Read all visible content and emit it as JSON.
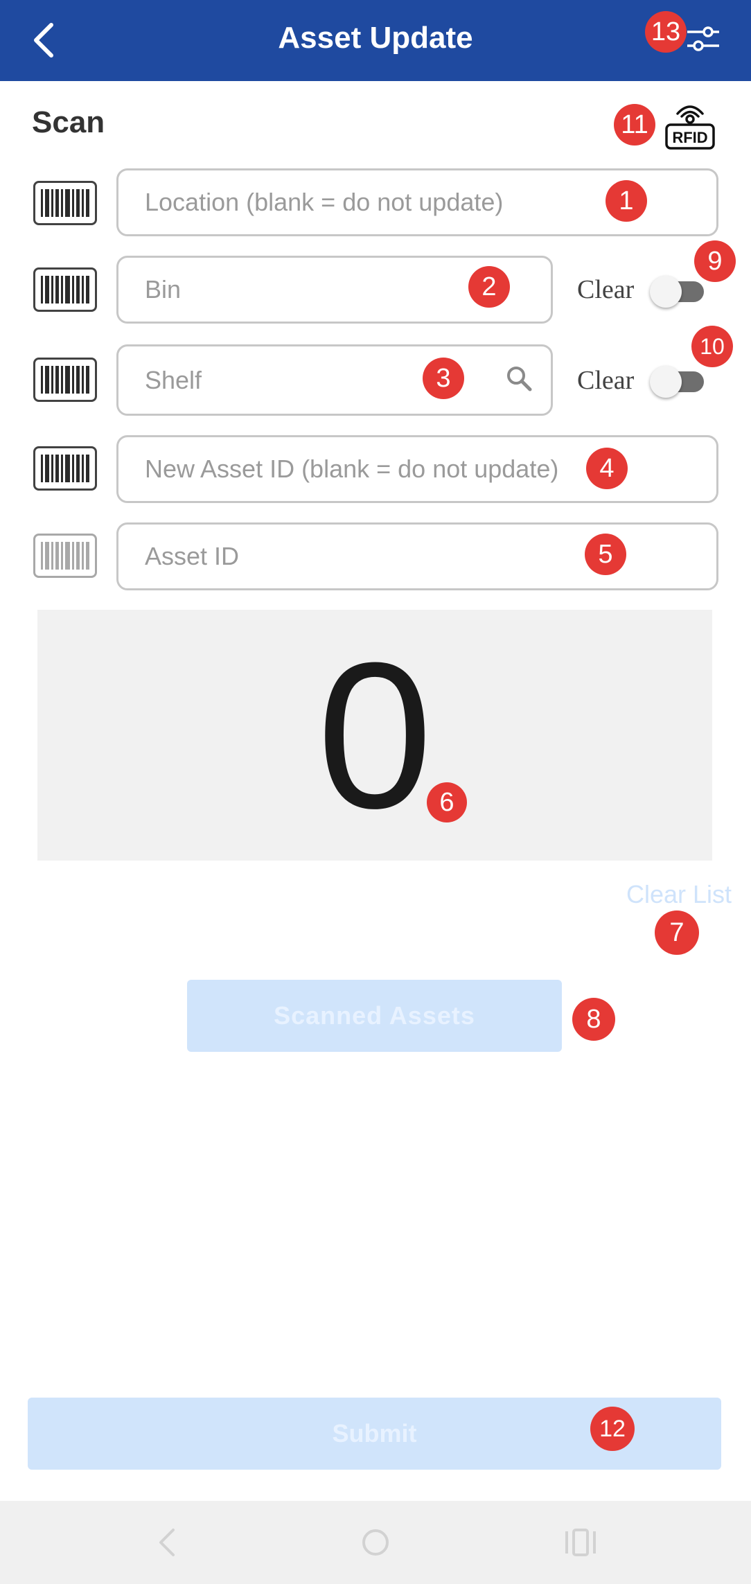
{
  "header": {
    "title": "Asset Update",
    "back_icon": "chevron-left-icon",
    "settings_icon": "sliders-icon",
    "background": "#1f4aa0"
  },
  "scan": {
    "label": "Scan",
    "rfid_icon": "rfid-icon",
    "rfid_text": "RFID"
  },
  "fields": {
    "location": {
      "placeholder": "Location (blank = do not update)",
      "value": ""
    },
    "bin": {
      "placeholder": "Bin",
      "value": "",
      "clear_label": "Clear",
      "clear_on": false
    },
    "shelf": {
      "placeholder": "Shelf",
      "value": "",
      "clear_label": "Clear",
      "clear_on": false
    },
    "new_asset_id": {
      "placeholder": "New Asset ID (blank = do not update)",
      "value": ""
    },
    "asset_id": {
      "placeholder": "Asset ID",
      "value": ""
    }
  },
  "counter": {
    "value": "0"
  },
  "clear_list_label": "Clear List",
  "scanned_assets_label": "Scanned Assets",
  "submit_label": "Submit",
  "badges": {
    "location": "1",
    "bin": "2",
    "shelf": "3",
    "new_asset_id": "4",
    "asset_id": "5",
    "counter": "6",
    "clear_list": "7",
    "scanned_assets": "8",
    "bin_clear": "9",
    "shelf_clear": "10",
    "rfid": "11",
    "submit": "12",
    "settings": "13"
  },
  "colors": {
    "accent": "#1f4aa0",
    "badge": "#e53935",
    "disabled_button": "#d0e4fb"
  }
}
